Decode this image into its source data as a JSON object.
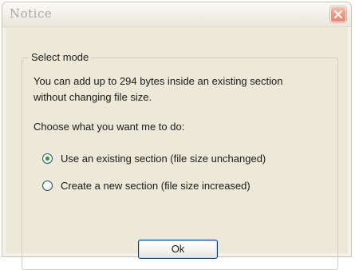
{
  "window": {
    "title": "Notice"
  },
  "group": {
    "legend": "Select mode"
  },
  "message": {
    "line1": "You can add up to 294 bytes inside an existing section",
    "line2": "without changing file size.",
    "prompt": "Choose what you want me to do:"
  },
  "options": [
    {
      "label": "Use an existing section (file size unchanged)",
      "selected": true
    },
    {
      "label": "Create a new section (file size increased)",
      "selected": false
    }
  ],
  "buttons": {
    "ok_label": "Ok"
  },
  "icons": {
    "close": "close-icon"
  },
  "colors": {
    "dialog_face": "#ece9d8",
    "close_button": "#e48a70",
    "radio_dot": "#21a121",
    "button_border": "#003c74"
  }
}
